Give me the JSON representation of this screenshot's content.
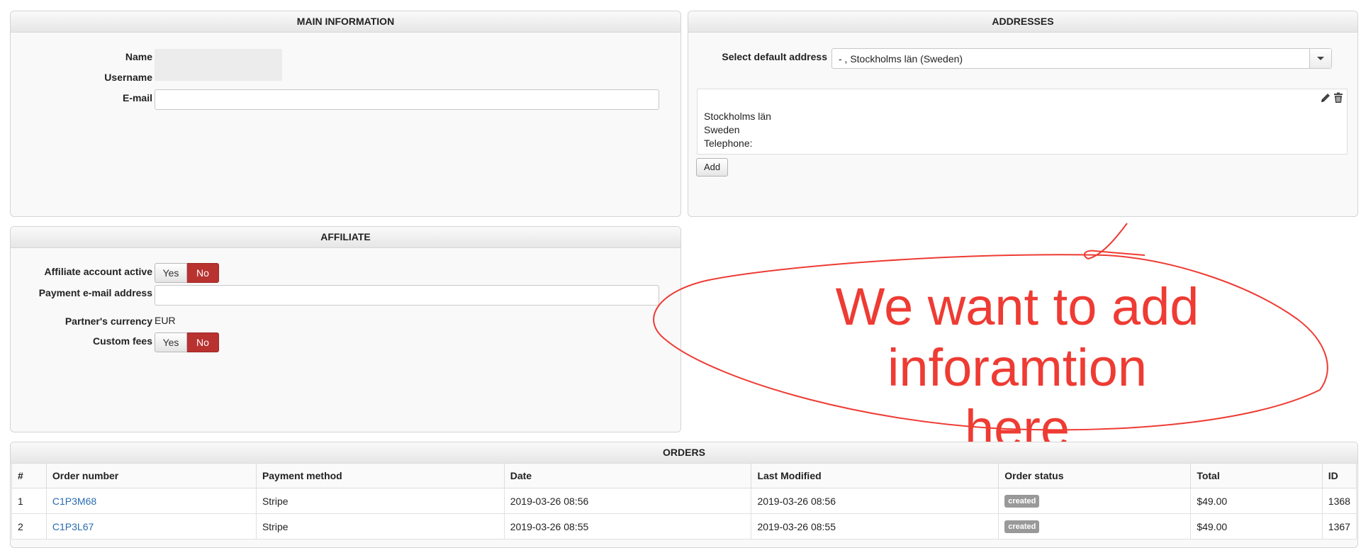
{
  "main_information": {
    "title": "MAIN INFORMATION",
    "name_label": "Name",
    "username_label": "Username",
    "email_label": "E-mail",
    "email_value": ""
  },
  "addresses": {
    "title": "ADDRESSES",
    "select_label": "Select default address",
    "selected_value": "- , Stockholms län (Sweden)",
    "card": {
      "line1": "Stockholms län",
      "line2": "Sweden",
      "line3": "Telephone:"
    },
    "add_label": "Add"
  },
  "affiliate": {
    "title": "AFFILIATE",
    "active_label": "Affiliate account active",
    "yes_label": "Yes",
    "no_label": "No",
    "payment_email_label": "Payment e-mail address",
    "payment_email_value": "",
    "currency_label": "Partner's currency",
    "currency_value": "EUR",
    "custom_fees_label": "Custom fees"
  },
  "annotation": {
    "line1": "We want to add",
    "line2": "inforamtion here",
    "color": "#ee3b33"
  },
  "orders": {
    "title": "ORDERS",
    "columns": [
      "#",
      "Order number",
      "Payment method",
      "Date",
      "Last Modified",
      "Order status",
      "Total",
      "ID"
    ],
    "rows": [
      {
        "num": "1",
        "order": "C1P3M68",
        "payment": "Stripe",
        "date": "2019-03-26 08:56",
        "modified": "2019-03-26 08:56",
        "status": "created",
        "total": "$49.00",
        "id": "1368"
      },
      {
        "num": "2",
        "order": "C1P3L67",
        "payment": "Stripe",
        "date": "2019-03-26 08:55",
        "modified": "2019-03-26 08:55",
        "status": "created",
        "total": "$49.00",
        "id": "1367"
      }
    ]
  },
  "colors": {
    "toggle_active": "#b83230",
    "link": "#2a6cb0",
    "badge": "#999999"
  }
}
